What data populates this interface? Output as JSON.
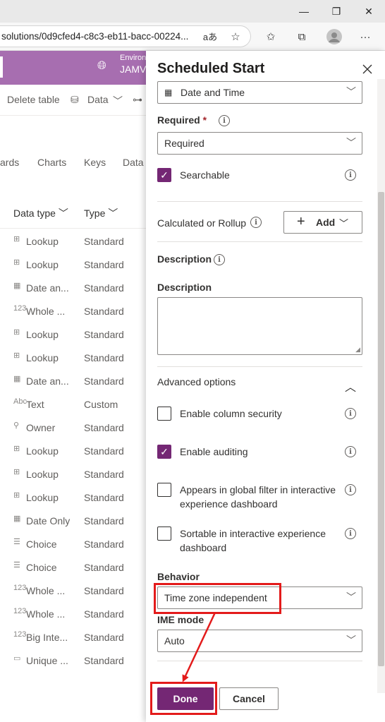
{
  "browser": {
    "url": "solutions/0d9cfed4-c8c3-eb11-bacc-00224...",
    "read_aloud": "aあ"
  },
  "app": {
    "environment_label": "Environ",
    "environment_name": "JAMV",
    "commands": {
      "delete_table": "Delete table",
      "data": "Data"
    },
    "tabs": [
      "ards",
      "Charts",
      "Keys",
      "Data"
    ],
    "columns": {
      "data_type": "Data type",
      "type": "Type"
    },
    "rows": [
      {
        "icon": "lookup-icon",
        "glyph": "⊞",
        "data_type": "Lookup",
        "type": "Standard"
      },
      {
        "icon": "lookup-icon",
        "glyph": "⊞",
        "data_type": "Lookup",
        "type": "Standard"
      },
      {
        "icon": "calendar-icon",
        "glyph": "▦",
        "data_type": "Date an...",
        "type": "Standard"
      },
      {
        "icon": "number-icon",
        "glyph": "123",
        "data_type": "Whole ...",
        "type": "Standard"
      },
      {
        "icon": "lookup-icon",
        "glyph": "⊞",
        "data_type": "Lookup",
        "type": "Standard"
      },
      {
        "icon": "lookup-icon",
        "glyph": "⊞",
        "data_type": "Lookup",
        "type": "Standard"
      },
      {
        "icon": "calendar-icon",
        "glyph": "▦",
        "data_type": "Date an...",
        "type": "Standard"
      },
      {
        "icon": "text-icon",
        "glyph": "Abc",
        "data_type": "Text",
        "type": "Custom"
      },
      {
        "icon": "person-icon",
        "glyph": "⚲",
        "data_type": "Owner",
        "type": "Standard"
      },
      {
        "icon": "lookup-icon",
        "glyph": "⊞",
        "data_type": "Lookup",
        "type": "Standard"
      },
      {
        "icon": "lookup-icon",
        "glyph": "⊞",
        "data_type": "Lookup",
        "type": "Standard"
      },
      {
        "icon": "lookup-icon",
        "glyph": "⊞",
        "data_type": "Lookup",
        "type": "Standard"
      },
      {
        "icon": "calendar-icon",
        "glyph": "▦",
        "data_type": "Date Only",
        "type": "Standard"
      },
      {
        "icon": "list-icon",
        "glyph": "☰",
        "data_type": "Choice",
        "type": "Standard"
      },
      {
        "icon": "list-icon",
        "glyph": "☰",
        "data_type": "Choice",
        "type": "Standard"
      },
      {
        "icon": "number-icon",
        "glyph": "123",
        "data_type": "Whole ...",
        "type": "Standard"
      },
      {
        "icon": "number-icon",
        "glyph": "123",
        "data_type": "Whole ...",
        "type": "Standard"
      },
      {
        "icon": "number-icon",
        "glyph": "123",
        "data_type": "Big Inte...",
        "type": "Standard"
      },
      {
        "icon": "unique-id-icon",
        "glyph": "▭",
        "data_type": "Unique ...",
        "type": "Standard"
      }
    ]
  },
  "panel": {
    "title": "Scheduled Start",
    "data_type_value": "Date and Time",
    "required": {
      "label": "Required",
      "asterisk": "*",
      "value": "Required"
    },
    "searchable": {
      "label": "Searchable",
      "checked": true
    },
    "calculated": {
      "label": "Calculated or Rollup",
      "add_label": "Add"
    },
    "description_heading": "Description",
    "description_label": "Description",
    "description_value": "",
    "advanced": {
      "label": "Advanced options",
      "options": [
        {
          "label": "Enable column security",
          "checked": false
        },
        {
          "label": "Enable auditing",
          "checked": true
        },
        {
          "label": "Appears in global filter in interactive experience dashboard",
          "checked": false
        },
        {
          "label": "Sortable in interactive experience dashboard",
          "checked": false
        }
      ]
    },
    "behavior": {
      "label": "Behavior",
      "value": "Time zone independent"
    },
    "ime_mode": {
      "label": "IME mode",
      "value": "Auto"
    },
    "done_label": "Done",
    "cancel_label": "Cancel"
  },
  "colors": {
    "accent": "#742774",
    "header": "#a76eb0",
    "annotation": "#e31b1b"
  }
}
